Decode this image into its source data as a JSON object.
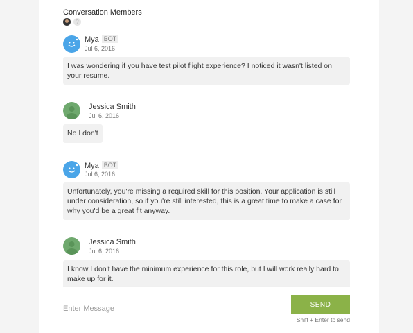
{
  "header": {
    "title": "Conversation Members",
    "unknown_member_glyph": "?"
  },
  "messages": [
    {
      "sender": "Mya",
      "badge": "BOT",
      "date": "Jul 6, 2016",
      "text": "I was wondering if you have test pilot flight experience? I noticed it wasn't listed on your resume."
    },
    {
      "sender": "Jessica Smith",
      "date": "Jul 6, 2016",
      "text": "No I don't"
    },
    {
      "sender": "Mya",
      "badge": "BOT",
      "date": "Jul 6, 2016",
      "text": "Unfortunately, you're missing a required skill for this position. Your application is still under consideration, so if you're still interested, this is a great time to make a case for why you'd be a great fit anyway."
    },
    {
      "sender": "Jessica Smith",
      "date": "Jul 6, 2016",
      "text": "I know I don't have the minimum experience for this role, but I will work really hard to make up for it."
    }
  ],
  "composer": {
    "placeholder": "Enter Message",
    "send_label": "SEND",
    "hint": "Shift + Enter to send"
  },
  "colors": {
    "bot_avatar": "#4aa5e8",
    "user_avatar": "#6fa96e",
    "send_button": "#8bb248"
  }
}
